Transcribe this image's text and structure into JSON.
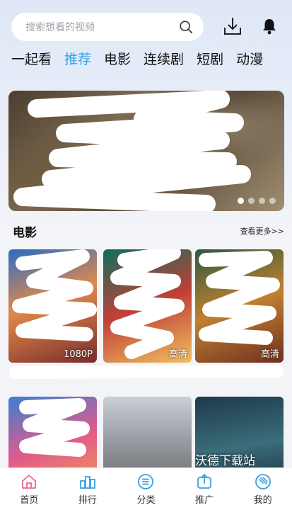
{
  "search": {
    "placeholder": "搜索想看的视频"
  },
  "tabs": [
    {
      "label": "一起看",
      "active": false
    },
    {
      "label": "推荐",
      "active": true
    },
    {
      "label": "电影",
      "active": false
    },
    {
      "label": "连续剧",
      "active": false
    },
    {
      "label": "短剧",
      "active": false
    },
    {
      "label": "动漫",
      "active": false
    }
  ],
  "banner": {
    "dots": 4,
    "active_dot": 0
  },
  "section": {
    "title": "电影",
    "see_more": "查看更多>>"
  },
  "posters": [
    {
      "badge": "1080P"
    },
    {
      "badge": "高清"
    },
    {
      "badge": "高清"
    },
    {
      "badge": ""
    },
    {
      "badge": ""
    },
    {
      "badge": ""
    }
  ],
  "watermark": "沃德下载站",
  "nav": [
    {
      "label": "首页",
      "icon": "home-icon",
      "active": true
    },
    {
      "label": "排行",
      "icon": "ranking-icon",
      "active": false
    },
    {
      "label": "分类",
      "icon": "category-icon",
      "active": false
    },
    {
      "label": "推广",
      "icon": "share-icon",
      "active": false
    },
    {
      "label": "我的",
      "icon": "profile-icon",
      "active": false
    }
  ],
  "colors": {
    "accent": "#2fa4e7",
    "home_icon": "#e86a8a",
    "nav_icon": "#3aa0e0"
  }
}
